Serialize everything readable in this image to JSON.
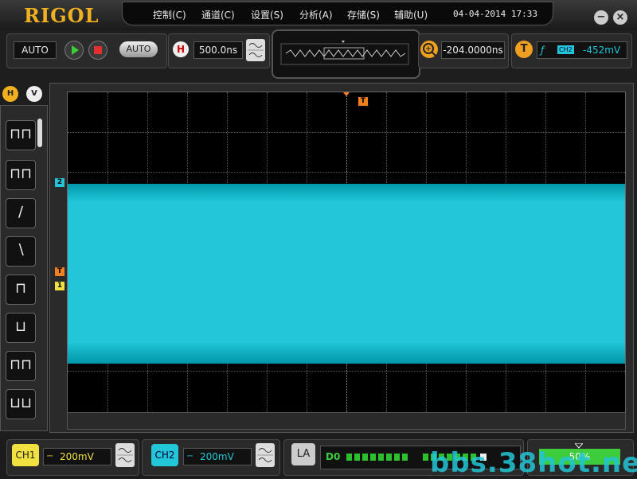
{
  "app": {
    "logo": "RIGOL"
  },
  "menu": {
    "items": [
      "控制(C)",
      "通道(C)",
      "设置(S)",
      "分析(A)",
      "存储(S)",
      "辅助(U)"
    ],
    "datetime": "04-04-2014  17:33"
  },
  "window": {
    "minimize": "−",
    "close": "×"
  },
  "controls": {
    "mode": "AUTO",
    "auto_button": "AUTO",
    "horizontal_badge": "H",
    "timebase": "500.0ns",
    "delay": "-204.0000ns",
    "trigger_badge": "T",
    "trigger_source": "CH2",
    "trigger_level": "-452mV"
  },
  "sidebar": {
    "tab_h": "H",
    "tab_v": "V"
  },
  "markers": {
    "ch2": "2",
    "trigger": "T",
    "ch1": "1"
  },
  "bottom": {
    "ch1": {
      "label": "CH1",
      "scale": "200mV"
    },
    "ch2": {
      "label": "CH2",
      "scale": "200mV"
    },
    "la": {
      "label": "LA",
      "channel": "D0"
    },
    "level": "50%",
    "watermark": "bbs.38hot.net"
  },
  "colors": {
    "ch1": "#f0e040",
    "ch2": "#22c6d8",
    "accent": "#f0b020",
    "trigger": "#f08020"
  }
}
